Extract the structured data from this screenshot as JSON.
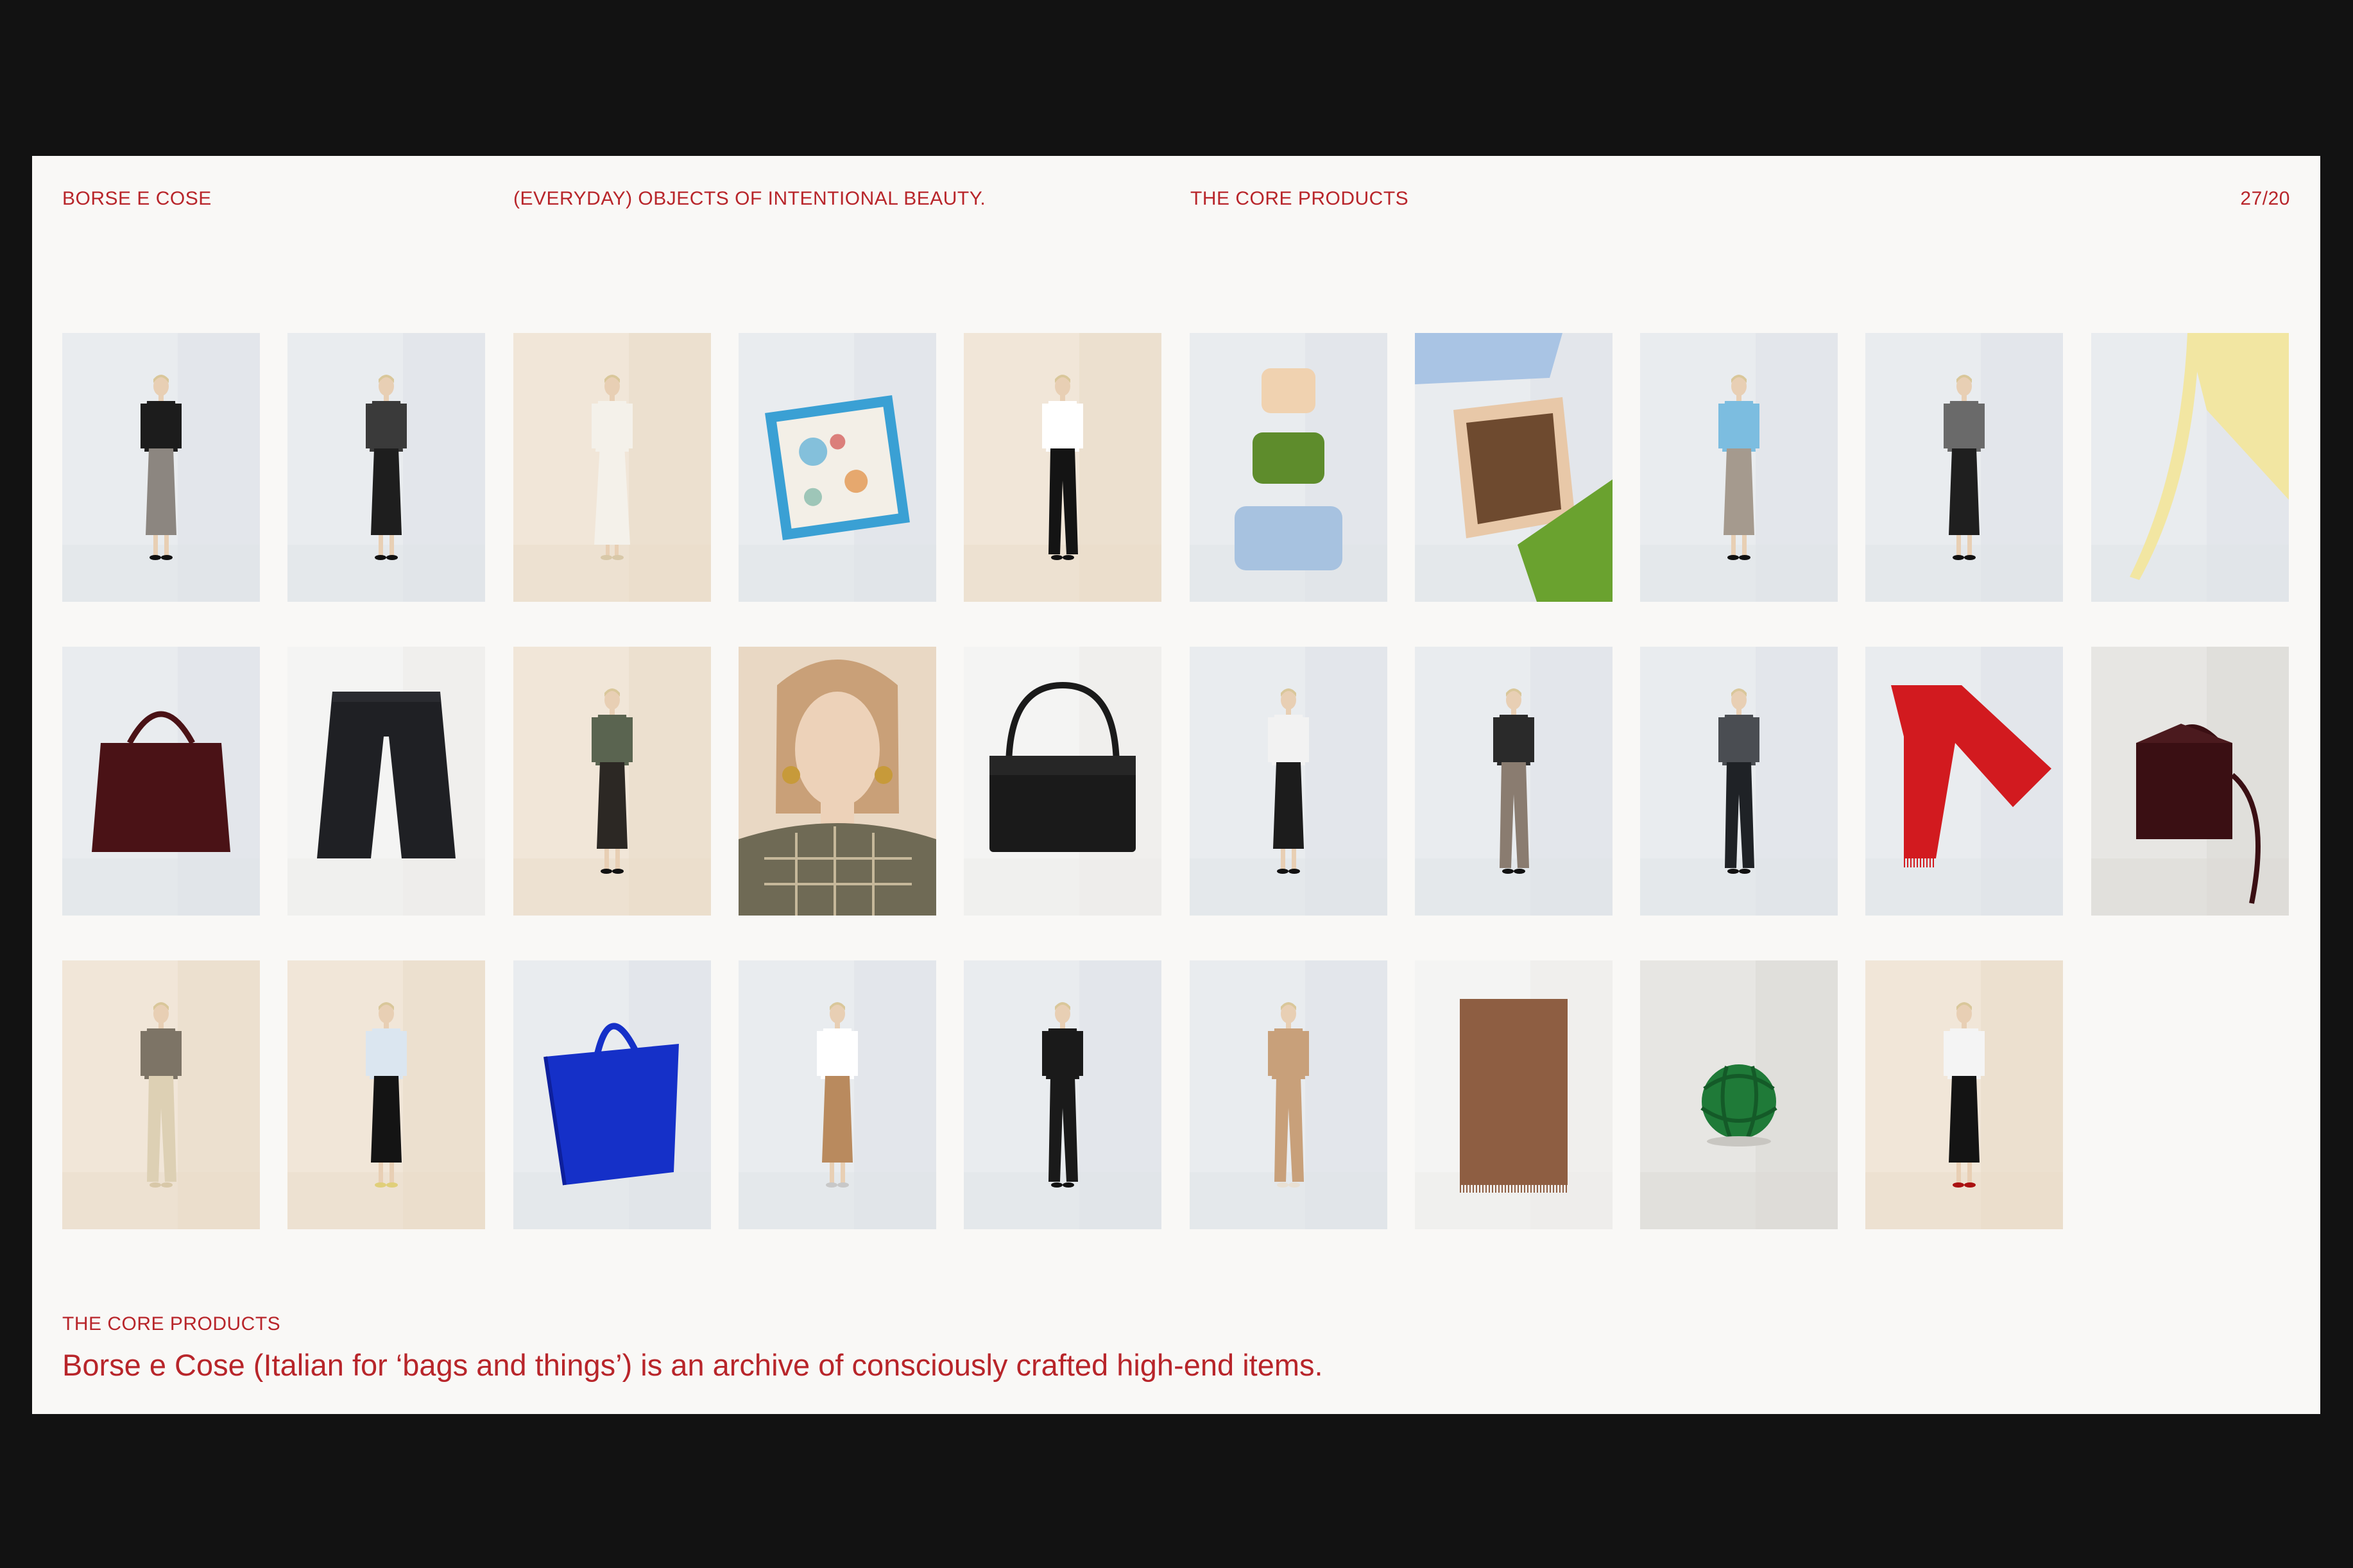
{
  "header": {
    "brand": "BORSE E COSE",
    "tagline": "(EVERYDAY) OBJECTS OF INTENTIONAL BEAUTY.",
    "section": "THE CORE PRODUCTS",
    "page_number": "27/20"
  },
  "caption": {
    "label": "THE CORE PRODUCTS",
    "body": "Borse e Cose (Italian for ‘bags and things’) is an archive of consciously crafted high-end items."
  },
  "colors": {
    "accent": "#b8252a",
    "page_bg": "#f9f8f6",
    "frame_bg": "#121212"
  },
  "tiles": [
    {
      "kind": "person",
      "bg": "cool",
      "top": "#1c1c1c",
      "bottom": "#8c8680",
      "bottom_type": "skirt",
      "shoes": "#111"
    },
    {
      "kind": "person",
      "bg": "cool",
      "top": "#3a3a3a",
      "bottom": "#1e1e1e",
      "bottom_type": "skirt",
      "shoes": "#111"
    },
    {
      "kind": "person",
      "bg": "warm",
      "top": "#f4f1ea",
      "bottom": "#f4f1ea",
      "bottom_type": "dress",
      "shoes": "#d8c8a8"
    },
    {
      "kind": "scarf",
      "bg": "cool",
      "main": "#3aa0d4",
      "accent": "#f3efe7"
    },
    {
      "kind": "person",
      "bg": "warm",
      "top": "#ffffff",
      "bottom": "#141414",
      "bottom_type": "trousers",
      "shoes": "#111"
    },
    {
      "kind": "trays",
      "bg": "cool",
      "c1": "#f0d2b0",
      "c2": "#5e8c2c",
      "c3": "#a7c2e0"
    },
    {
      "kind": "tray-closeup",
      "bg": "cool",
      "c1": "#a9c4e4",
      "c2": "#6e4a2f",
      "c3": "#6aa22f"
    },
    {
      "kind": "person",
      "bg": "cool",
      "top": "#7cbde0",
      "bottom": "#a59a8e",
      "bottom_type": "skirt",
      "shoes": "#111"
    },
    {
      "kind": "person",
      "bg": "cool",
      "top": "#6a6a6a",
      "bottom": "#1f1f1f",
      "bottom_type": "skirt",
      "shoes": "#111"
    },
    {
      "kind": "yellow-bag",
      "bg": "cool",
      "main": "#f2e6a2"
    },
    {
      "kind": "tote",
      "bg": "cool",
      "main": "#4a1216"
    },
    {
      "kind": "trousers",
      "bg": "white",
      "main": "#1f2024"
    },
    {
      "kind": "person",
      "bg": "warm",
      "top": "#5a6450",
      "bottom": "#2c2824",
      "bottom_type": "skirt",
      "shoes": "#111"
    },
    {
      "kind": "portrait",
      "bg": "warm",
      "main": "#6f6a55"
    },
    {
      "kind": "shoulder-bag",
      "bg": "white",
      "main": "#1a1a1a"
    },
    {
      "kind": "person",
      "bg": "cool",
      "top": "#f2f2f2",
      "bottom": "#1c1c1c",
      "bottom_type": "skirt",
      "shoes": "#111"
    },
    {
      "kind": "person",
      "bg": "cool",
      "top": "#2a2a2a",
      "bottom": "#8a7c70",
      "bottom_type": "trousers",
      "shoes": "#111"
    },
    {
      "kind": "person",
      "bg": "cool",
      "top": "#4a4d52",
      "bottom": "#1f2226",
      "bottom_type": "trousers",
      "shoes": "#111"
    },
    {
      "kind": "red-scarf",
      "bg": "cool",
      "main": "#d21a1f"
    },
    {
      "kind": "box-bag",
      "bg": "grey",
      "main": "#3a0f13"
    },
    {
      "kind": "person",
      "bg": "warm",
      "top": "#7d7466",
      "bottom": "#ddd0b4",
      "bottom_type": "trousers",
      "shoes": "#d8c8a8"
    },
    {
      "kind": "person",
      "bg": "warm",
      "top": "#dbe6f0",
      "bottom": "#141414",
      "bottom_type": "skirt",
      "shoes": "#e0cf7a"
    },
    {
      "kind": "blue-tote",
      "bg": "cool",
      "main": "#1530c8"
    },
    {
      "kind": "person",
      "bg": "cool",
      "top": "#ffffff",
      "bottom": "#b98a5e",
      "bottom_type": "skirt",
      "shoes": "#c8c8c8"
    },
    {
      "kind": "person",
      "bg": "cool",
      "top": "#1a1a1a",
      "bottom": "#1a1a1a",
      "bottom_type": "trousers",
      "shoes": "#111"
    },
    {
      "kind": "person",
      "bg": "cool",
      "top": "#c8a07a",
      "bottom": "#c8a07a",
      "bottom_type": "trousers",
      "shoes": "#e8e0d4"
    },
    {
      "kind": "brown-scarf",
      "bg": "white",
      "main": "#8e5e42"
    },
    {
      "kind": "knot",
      "bg": "grey",
      "main": "#1f7a38"
    },
    {
      "kind": "person",
      "bg": "warm",
      "top": "#f4f4f4",
      "bottom": "#141414",
      "bottom_type": "skirt",
      "shoes": "#a11"
    }
  ]
}
